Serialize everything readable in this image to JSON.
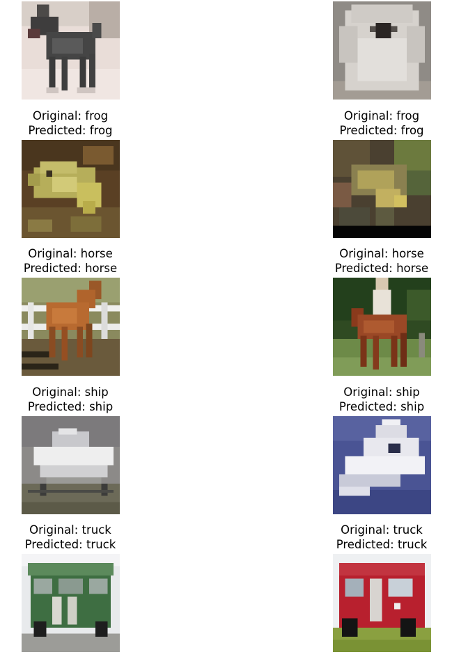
{
  "figure": {
    "rows": [
      {
        "class": "dog",
        "captions": [
          {
            "original": "",
            "predicted": ""
          },
          {
            "original": "",
            "predicted": ""
          }
        ],
        "images": [
          "dark-dog-standing-photo",
          "white-fluffy-dog-photo"
        ]
      },
      {
        "class": "frog",
        "captions": [
          {
            "original": "Original: frog",
            "predicted": "Predicted: frog"
          },
          {
            "original": "Original: frog",
            "predicted": "Predicted: frog"
          }
        ],
        "images": [
          "yellow-frog-photo",
          "frog-on-ground-photo"
        ]
      },
      {
        "class": "horse",
        "captions": [
          {
            "original": "Original: horse",
            "predicted": "Predicted: horse"
          },
          {
            "original": "Original: horse",
            "predicted": "Predicted: horse"
          }
        ],
        "images": [
          "brown-horse-by-fence-photo",
          "horse-with-rider-photo"
        ]
      },
      {
        "class": "ship",
        "captions": [
          {
            "original": "Original: ship",
            "predicted": "Predicted: ship"
          },
          {
            "original": "Original: ship",
            "predicted": "Predicted: ship"
          }
        ],
        "images": [
          "white-boat-on-trailer-photo",
          "white-motorboat-on-water-photo"
        ]
      },
      {
        "class": "truck",
        "captions": [
          {
            "original": "Original: truck",
            "predicted": "Predicted: truck"
          },
          {
            "original": "Original: truck",
            "predicted": "Predicted: truck"
          }
        ],
        "images": [
          "green-truck-photo",
          "red-truck-photo"
        ]
      }
    ]
  }
}
